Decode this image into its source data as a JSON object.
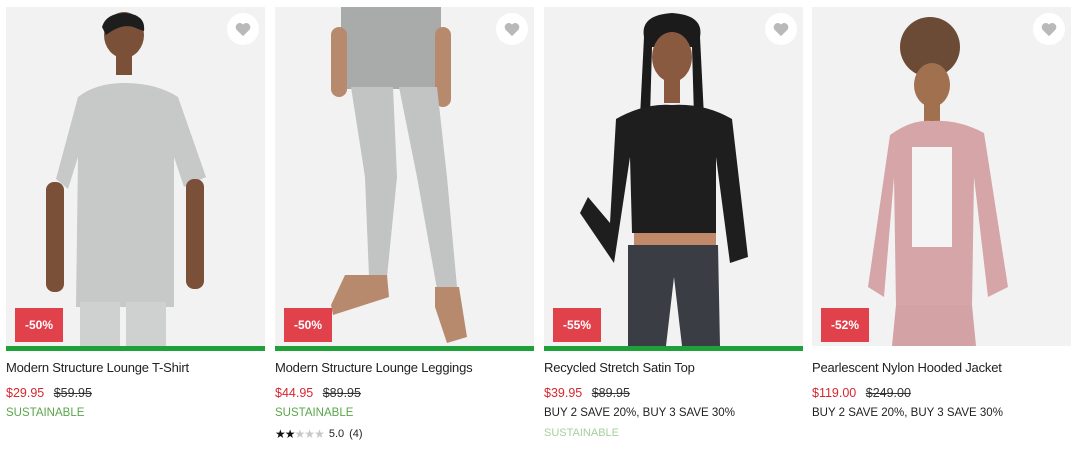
{
  "products": [
    {
      "title": "Modern Structure Lounge T-Shirt",
      "discount": "-50%",
      "price_now": "$29.95",
      "price_was": "$59.95",
      "tag": "SUSTAINABLE"
    },
    {
      "title": "Modern Structure Lounge Leggings",
      "discount": "-50%",
      "price_now": "$44.95",
      "price_was": "$89.95",
      "tag": "SUSTAINABLE",
      "rating_score": "5.0",
      "rating_count": "(4)",
      "rating_stars": 2
    },
    {
      "title": "Recycled Stretch Satin Top",
      "discount": "-55%",
      "price_now": "$39.95",
      "price_was": "$89.95",
      "promo": "BUY 2 SAVE 20%, BUY 3 SAVE 30%",
      "tag": "SUSTAINABLE"
    },
    {
      "title": "Pearlescent Nylon Hooded Jacket",
      "discount": "-52%",
      "price_now": "$119.00",
      "price_was": "$249.00",
      "promo": "BUY 2 SAVE 20%, BUY 3 SAVE 30%"
    }
  ],
  "colors": {
    "sale_badge": "#e0414b",
    "sale_price": "#d7262e",
    "sustainable": "#5aa64a",
    "availability_bar": "#1fa13a"
  },
  "icons": {
    "favorite": "heart-icon",
    "star_filled": "star-filled-icon",
    "star_empty": "star-empty-icon"
  }
}
